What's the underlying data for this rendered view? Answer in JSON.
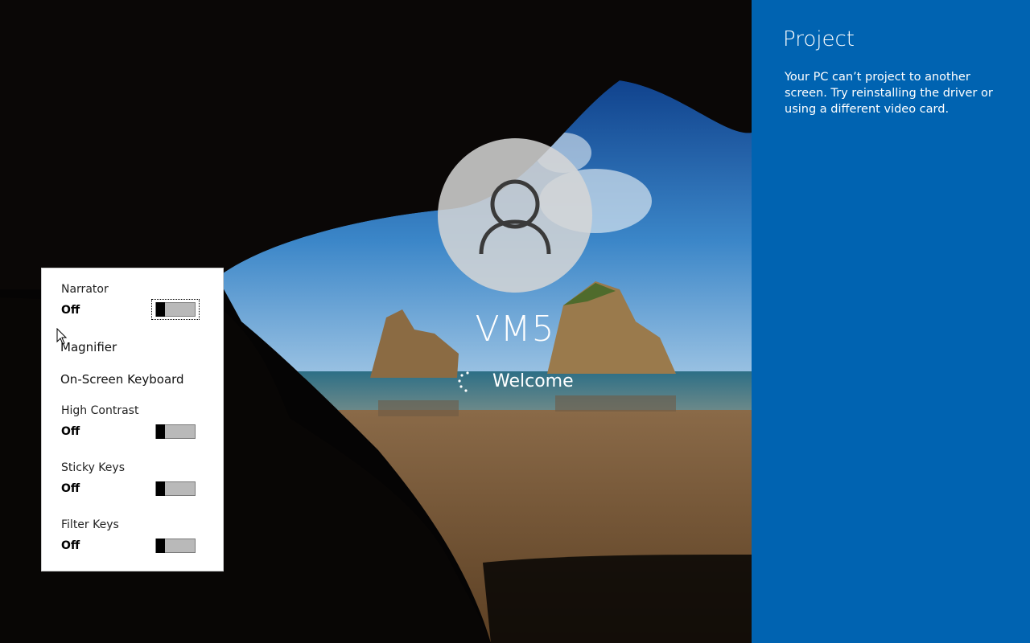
{
  "user": {
    "name": "VM5",
    "status": "Welcome"
  },
  "ease_of_access": {
    "narrator": {
      "label": "Narrator",
      "state": "Off",
      "on": false
    },
    "magnifier_label": "Magnifier",
    "osk_label": "On-Screen Keyboard",
    "high_contrast": {
      "label": "High Contrast",
      "state": "Off",
      "on": false
    },
    "sticky_keys": {
      "label": "Sticky Keys",
      "state": "Off",
      "on": false
    },
    "filter_keys": {
      "label": "Filter Keys",
      "state": "Off",
      "on": false
    }
  },
  "project": {
    "title": "Project",
    "message": "Your PC can’t project to another screen. Try reinstalling the driver or using a different video card."
  },
  "icons": {
    "avatar": "user-silhouette-icon",
    "spinner": "loading-spinner-icon",
    "cursor": "mouse-pointer-icon"
  },
  "colors": {
    "panel": "#0063b1",
    "flyout": "#ffffff",
    "toggle_off": "#b9b9b9"
  }
}
